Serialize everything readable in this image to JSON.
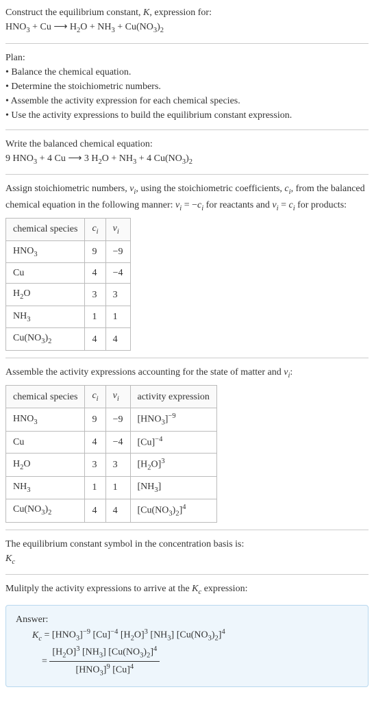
{
  "intro": {
    "line1": "Construct the equilibrium constant, K, expression for:",
    "line2": "HNO₃ + Cu ⟶ H₂O + NH₃ + Cu(NO₃)₂"
  },
  "plan": {
    "title": "Plan:",
    "items": [
      "• Balance the chemical equation.",
      "• Determine the stoichiometric numbers.",
      "• Assemble the activity expression for each chemical species.",
      "• Use the activity expressions to build the equilibrium constant expression."
    ]
  },
  "balanced": {
    "title": "Write the balanced chemical equation:",
    "eq": "9 HNO₃ + 4 Cu ⟶ 3 H₂O + NH₃ + 4 Cu(NO₃)₂"
  },
  "stoich": {
    "intro": "Assign stoichiometric numbers, νᵢ, using the stoichiometric coefficients, cᵢ, from the balanced chemical equation in the following manner: νᵢ = −cᵢ for reactants and νᵢ = cᵢ for products:",
    "headers": {
      "c1": "chemical species",
      "c2": "cᵢ",
      "c3": "νᵢ"
    },
    "rows": [
      {
        "c1": "HNO₃",
        "c2": "9",
        "c3": "−9"
      },
      {
        "c1": "Cu",
        "c2": "4",
        "c3": "−4"
      },
      {
        "c1": "H₂O",
        "c2": "3",
        "c3": "3"
      },
      {
        "c1": "NH₃",
        "c2": "1",
        "c3": "1"
      },
      {
        "c1": "Cu(NO₃)₂",
        "c2": "4",
        "c3": "4"
      }
    ]
  },
  "activity": {
    "intro": "Assemble the activity expressions accounting for the state of matter and νᵢ:",
    "headers": {
      "c1": "chemical species",
      "c2": "cᵢ",
      "c3": "νᵢ",
      "c4": "activity expression"
    },
    "rows": [
      {
        "c1": "HNO₃",
        "c2": "9",
        "c3": "−9",
        "c4": "[HNO₃]⁻⁹"
      },
      {
        "c1": "Cu",
        "c2": "4",
        "c3": "−4",
        "c4": "[Cu]⁻⁴"
      },
      {
        "c1": "H₂O",
        "c2": "3",
        "c3": "3",
        "c4": "[H₂O]³"
      },
      {
        "c1": "NH₃",
        "c2": "1",
        "c3": "1",
        "c4": "[NH₃]"
      },
      {
        "c1": "Cu(NO₃)₂",
        "c2": "4",
        "c3": "4",
        "c4": "[Cu(NO₃)₂]⁴"
      }
    ]
  },
  "symbol": {
    "line1": "The equilibrium constant symbol in the concentration basis is:",
    "line2": "K_c"
  },
  "multiply": "Mulitply the activity expressions to arrive at the K_c expression:",
  "answer": {
    "label": "Answer:",
    "line1": "K_c = [HNO₃]⁻⁹ [Cu]⁻⁴ [H₂O]³ [NH₃] [Cu(NO₃)₂]⁴",
    "eq": "=",
    "num": "[H₂O]³ [NH₃] [Cu(NO₃)₂]⁴",
    "den": "[HNO₃]⁹ [Cu]⁴"
  },
  "chart_data": {
    "type": "table",
    "tables": [
      {
        "title": "Stoichiometric numbers",
        "columns": [
          "chemical species",
          "c_i",
          "ν_i"
        ],
        "rows": [
          [
            "HNO3",
            9,
            -9
          ],
          [
            "Cu",
            4,
            -4
          ],
          [
            "H2O",
            3,
            3
          ],
          [
            "NH3",
            1,
            1
          ],
          [
            "Cu(NO3)2",
            4,
            4
          ]
        ]
      },
      {
        "title": "Activity expressions",
        "columns": [
          "chemical species",
          "c_i",
          "ν_i",
          "activity expression"
        ],
        "rows": [
          [
            "HNO3",
            9,
            -9,
            "[HNO3]^-9"
          ],
          [
            "Cu",
            4,
            -4,
            "[Cu]^-4"
          ],
          [
            "H2O",
            3,
            3,
            "[H2O]^3"
          ],
          [
            "NH3",
            1,
            1,
            "[NH3]"
          ],
          [
            "Cu(NO3)2",
            4,
            4,
            "[Cu(NO3)2]^4"
          ]
        ]
      }
    ]
  }
}
